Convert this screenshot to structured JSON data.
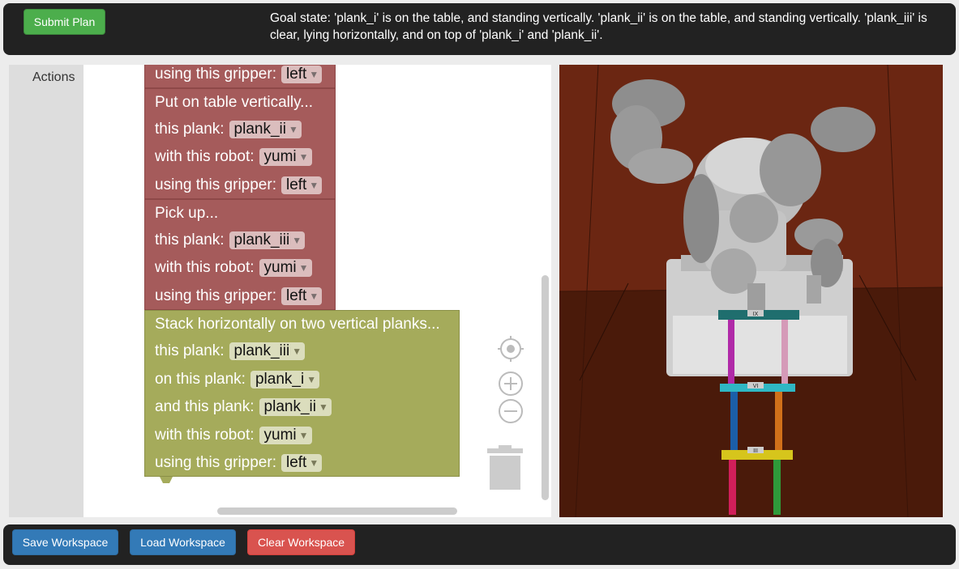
{
  "header": {
    "submit_label": "Submit Plan",
    "goal_text": "Goal state: 'plank_i' is on the table, and standing vertically. 'plank_ii' is on the table, and standing vertically. 'plank_iii' is clear, lying horizontally, and on top of 'plank_i' and 'plank_ii'."
  },
  "toolbox": {
    "category": "Actions"
  },
  "blocks": {
    "b0": {
      "label": "using this gripper:",
      "value": "left"
    },
    "b1": {
      "title": "Put on table vertically...",
      "plank_label": "this plank:",
      "plank_value": "plank_ii",
      "robot_label": "with this robot:",
      "robot_value": "yumi",
      "gripper_label": "using this gripper:",
      "gripper_value": "left"
    },
    "b2": {
      "title": "Pick up...",
      "plank_label": "this plank:",
      "plank_value": "plank_iii",
      "robot_label": "with this robot:",
      "robot_value": "yumi",
      "gripper_label": "using this gripper:",
      "gripper_value": "left"
    },
    "b3": {
      "title": "Stack horizontally on two vertical planks...",
      "plank_label": "this plank:",
      "plank_value": "plank_iii",
      "on_label": "on this plank:",
      "on_value": "plank_i",
      "and_label": "and this plank:",
      "and_value": "plank_ii",
      "robot_label": "with this robot:",
      "robot_value": "yumi",
      "gripper_label": "using this gripper:",
      "gripper_value": "left"
    }
  },
  "scene": {
    "label_top": "IX",
    "label_mid": "VI",
    "label_low": "III"
  },
  "footer": {
    "save_label": "Save Workspace",
    "load_label": "Load Workspace",
    "clear_label": "Clear Workspace"
  },
  "colors": {
    "action_block": "#a55b5b",
    "stack_block": "#a5ab5b",
    "submit": "#4cae4c",
    "save_load": "#337ab7",
    "clear": "#d9534f",
    "scene_wall": "#6b2612"
  },
  "icons": [
    "recenter-icon",
    "zoom-in-icon",
    "zoom-out-icon",
    "trash-icon",
    "dropdown-arrow-icon"
  ]
}
